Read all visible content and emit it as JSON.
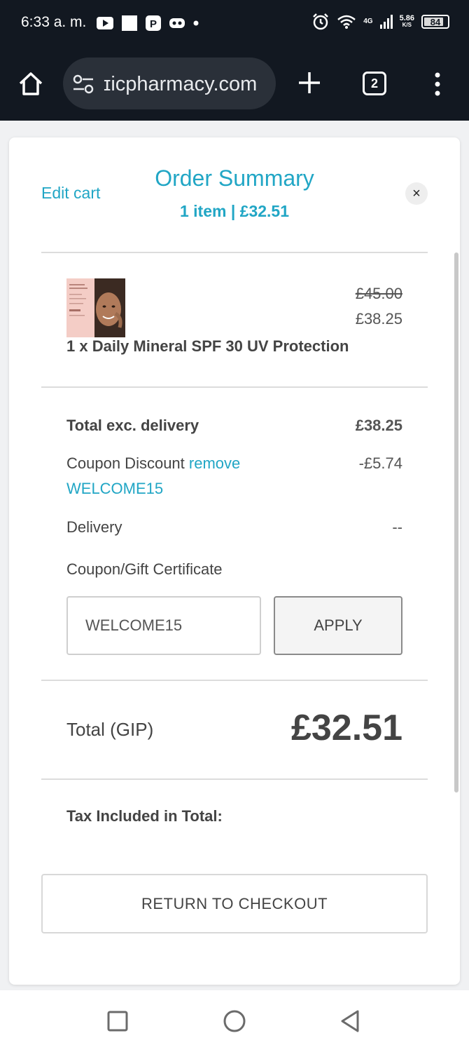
{
  "status_bar": {
    "time": "6:33 a. m.",
    "network": "4G",
    "speed_value": "5.86",
    "speed_unit": "K/S",
    "battery": "84",
    "battery_level": 0.84,
    "icons": [
      "youtube-icon",
      "square-icon",
      "p-icon",
      "infinity-icon",
      "dot-icon",
      "alarm-icon",
      "wifi-icon",
      "signal-icon",
      "battery-icon"
    ]
  },
  "browser": {
    "url": "ɪicpharmacy.com",
    "tab_count": "2"
  },
  "summary": {
    "edit_cart": "Edit cart",
    "title": "Order Summary",
    "subtitle": "1 item | £32.51",
    "close": "×"
  },
  "product": {
    "old_price": "£45.00",
    "new_price": "£38.25",
    "name": "1 x Daily Mineral SPF 30 UV Protection"
  },
  "totals": {
    "exc_delivery_label": "Total exc. delivery",
    "exc_delivery_value": "£38.25",
    "coupon_label": "Coupon Discount",
    "coupon_remove": "remove",
    "coupon_code": "WELCOME15",
    "coupon_value": "-£5.74",
    "delivery_label": "Delivery",
    "delivery_value": "--",
    "gift_label": "Coupon/Gift Certificate",
    "gift_input_value": "WELCOME15",
    "apply_label": "APPLY",
    "total_label": "Total (GIP)",
    "total_value": "£32.51",
    "tax_label": "Tax Included in Total:"
  },
  "actions": {
    "return_label": "RETURN TO CHECKOUT"
  },
  "colors": {
    "accent": "#21a6c5",
    "status_bg": "#121821"
  }
}
